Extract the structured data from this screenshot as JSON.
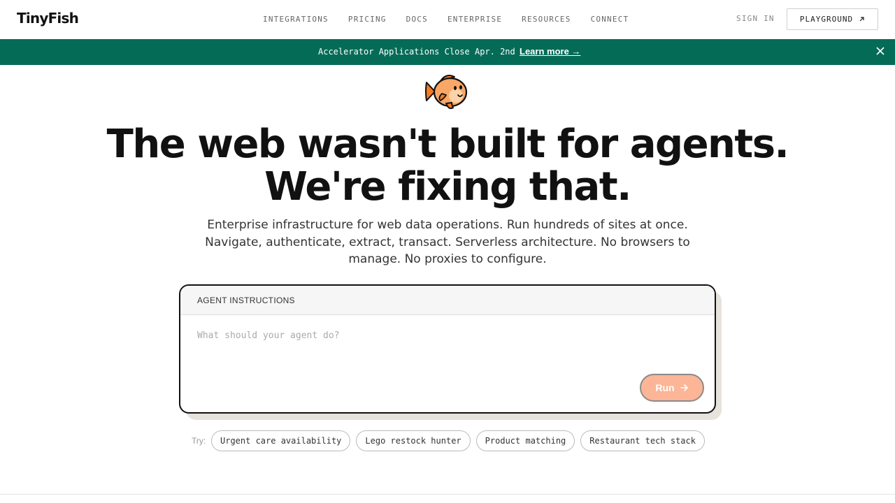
{
  "header": {
    "logo": "TinyFish",
    "nav": [
      "INTEGRATIONS",
      "PRICING",
      "DOCS",
      "ENTERPRISE",
      "RESOURCES",
      "CONNECT"
    ],
    "sign_in": "SIGN IN",
    "playground": "PLAYGROUND",
    "playground_icon": "arrow-up-right-icon"
  },
  "banner": {
    "text": "Accelerator Applications Close Apr. 2nd",
    "link": "Learn more →",
    "close_icon": "close-icon",
    "color": "#046b57"
  },
  "hero": {
    "title_line1": "The web wasn't built for agents.",
    "title_line2": "We're fixing that.",
    "subtitle": "Enterprise infrastructure for web data operations. Run hundreds of sites at once. Navigate, authenticate, extract, transact. Serverless architecture. No browsers to manage. No proxies to configure."
  },
  "agent": {
    "header": "AGENT INSTRUCTIONS",
    "placeholder": "What should your agent do?",
    "value": "",
    "run_label": "Run",
    "run_icon": "arrow-right-icon",
    "accent": "#fcb596"
  },
  "try": {
    "label": "Try:",
    "chips": [
      "Urgent care availability",
      "Lego restock hunter",
      "Product matching",
      "Restaurant tech stack"
    ]
  }
}
